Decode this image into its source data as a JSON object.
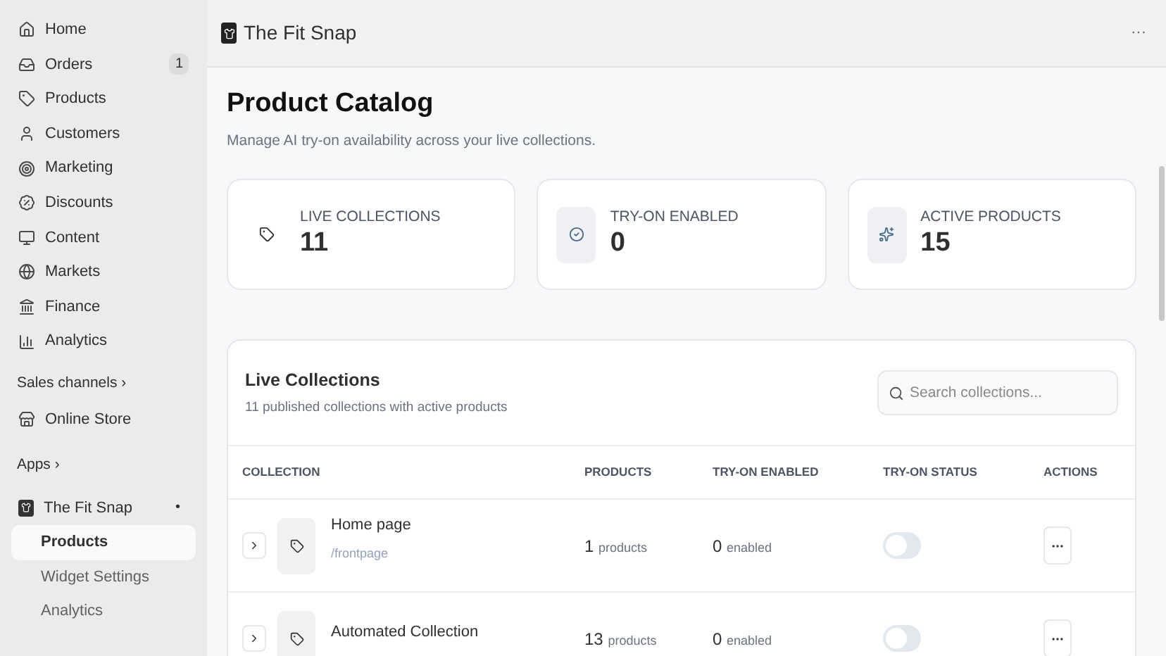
{
  "sidebar": {
    "items": [
      {
        "label": "Home"
      },
      {
        "label": "Orders",
        "badge": "1"
      },
      {
        "label": "Products"
      },
      {
        "label": "Customers"
      },
      {
        "label": "Marketing"
      },
      {
        "label": "Discounts"
      },
      {
        "label": "Content"
      },
      {
        "label": "Markets"
      },
      {
        "label": "Finance"
      },
      {
        "label": "Analytics"
      }
    ],
    "sales_channels": {
      "heading": "Sales channels ›",
      "items": [
        {
          "label": "Online Store"
        }
      ]
    },
    "apps": {
      "heading": "Apps ›",
      "app": {
        "label": "The Fit Snap",
        "pin": "•",
        "children": [
          {
            "label": "Products",
            "selected": true
          },
          {
            "label": "Widget Settings",
            "selected": false
          },
          {
            "label": "Analytics",
            "selected": false
          }
        ]
      }
    }
  },
  "header": {
    "title": "The Fit Snap",
    "menu": "···"
  },
  "page": {
    "title": "Product Catalog",
    "subtitle": "Manage AI try-on availability across your live collections."
  },
  "stats": [
    {
      "label": "LIVE COLLECTIONS",
      "value": "11"
    },
    {
      "label": "TRY-ON ENABLED",
      "value": "0"
    },
    {
      "label": "ACTIVE PRODUCTS",
      "value": "15"
    }
  ],
  "collections": {
    "title": "Live Collections",
    "subtitle": "11 published collections with active products",
    "search": {
      "placeholder": "Search collections..."
    },
    "columns": [
      "COLLECTION",
      "PRODUCTS",
      "TRY-ON ENABLED",
      "TRY-ON STATUS",
      "ACTIONS"
    ],
    "rows": [
      {
        "name": "Home page",
        "handle": "/frontpage",
        "products": "1",
        "products_unit": "products",
        "enabled": "0",
        "enabled_unit": "enabled",
        "on": false,
        "expanded": false
      },
      {
        "name": "Automated Collection",
        "products": "13",
        "products_unit": "products",
        "enabled": "0",
        "enabled_unit": "enabled",
        "on": false,
        "expanded": false
      }
    ]
  }
}
